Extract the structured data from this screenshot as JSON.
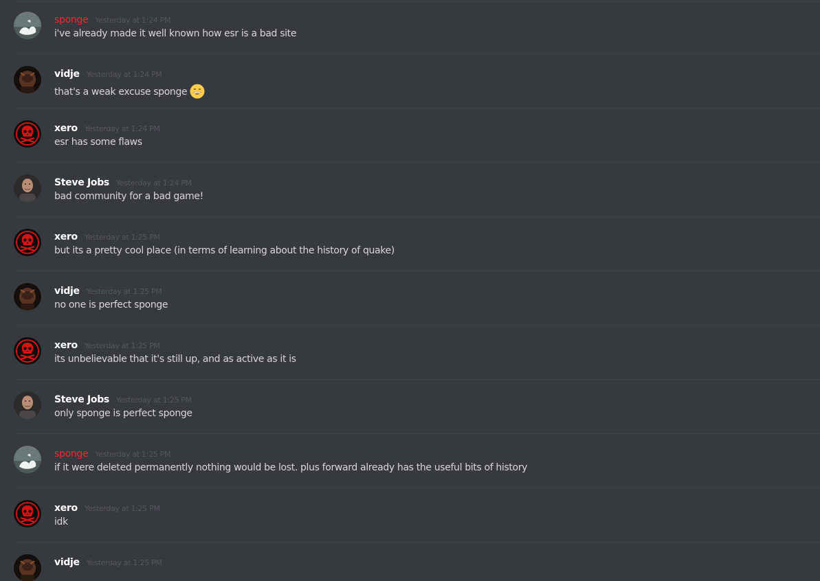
{
  "messages": [
    {
      "author": "sponge",
      "avatar": "sponge-avatar",
      "color": "#ee2a2a",
      "timestamp": "Yesterday at 1:24 PM",
      "text": "i've already made it well known how esr is a bad site"
    },
    {
      "author": "vidje",
      "avatar": "vidje-avatar",
      "color": "#ffffff",
      "timestamp": "Yesterday at 1:24 PM",
      "text": "that's a weak excuse sponge",
      "emoji": "grinning-face-emoji"
    },
    {
      "author": "xero",
      "avatar": "skull-avatar",
      "color": "#ffffff",
      "timestamp": "Yesterday at 1:24 PM",
      "text": "esr has some flaws"
    },
    {
      "author": "Steve Jobs",
      "avatar": "steve-jobs-avatar",
      "color": "#ffffff",
      "timestamp": "Yesterday at 1:24 PM",
      "text": "bad community for a bad game!"
    },
    {
      "author": "xero",
      "avatar": "skull-avatar",
      "color": "#ffffff",
      "timestamp": "Yesterday at 1:25 PM",
      "text": "but its a pretty cool place (in terms of learning about the history of quake)"
    },
    {
      "author": "vidje",
      "avatar": "vidje-avatar",
      "color": "#ffffff",
      "timestamp": "Yesterday at 1:25 PM",
      "text": "no one is perfect sponge"
    },
    {
      "author": "xero",
      "avatar": "skull-avatar",
      "color": "#ffffff",
      "timestamp": "Yesterday at 1:25 PM",
      "text": "its unbelievable that it's still up, and as active as it is"
    },
    {
      "author": "Steve Jobs",
      "avatar": "steve-jobs-avatar",
      "color": "#ffffff",
      "timestamp": "Yesterday at 1:25 PM",
      "text": "only sponge is perfect sponge"
    },
    {
      "author": "sponge",
      "avatar": "sponge-avatar",
      "color": "#ee2a2a",
      "timestamp": "Yesterday at 1:25 PM",
      "text": "if it were deleted permanently nothing would be lost. plus forward already has the useful bits of history"
    },
    {
      "author": "xero",
      "avatar": "skull-avatar",
      "color": "#ffffff",
      "timestamp": "Yesterday at 1:25 PM",
      "text": "idk"
    },
    {
      "author": "vidje",
      "avatar": "vidje-avatar",
      "color": "#ffffff",
      "timestamp": "Yesterday at 1:25 PM",
      "text": ""
    }
  ]
}
